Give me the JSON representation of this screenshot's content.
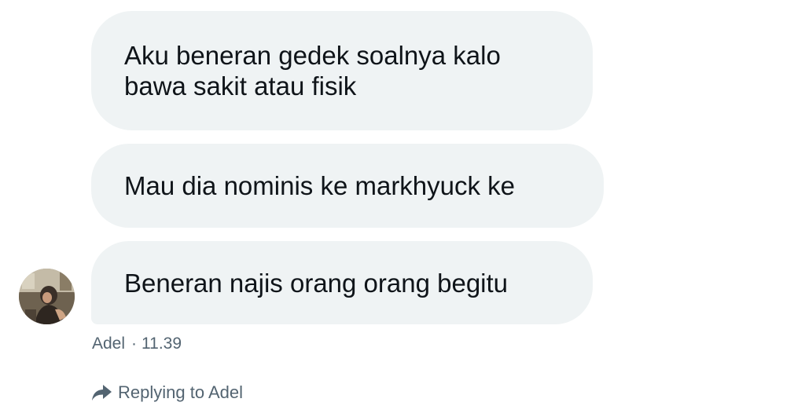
{
  "messages": [
    {
      "text": "Aku beneran gedek soalnya kalo bawa sakit atau fisik"
    },
    {
      "text": "Mau dia nominis ke markhyuck ke"
    },
    {
      "text": "Beneran najis orang orang begitu"
    }
  ],
  "meta": {
    "sender": "Adel",
    "separator": "·",
    "time": "11.39"
  },
  "reply": {
    "icon": "reply-arrow-icon",
    "label": "Replying to Adel"
  },
  "colors": {
    "bubble": "#eff3f4",
    "text": "#0f1419",
    "muted": "#536471"
  }
}
